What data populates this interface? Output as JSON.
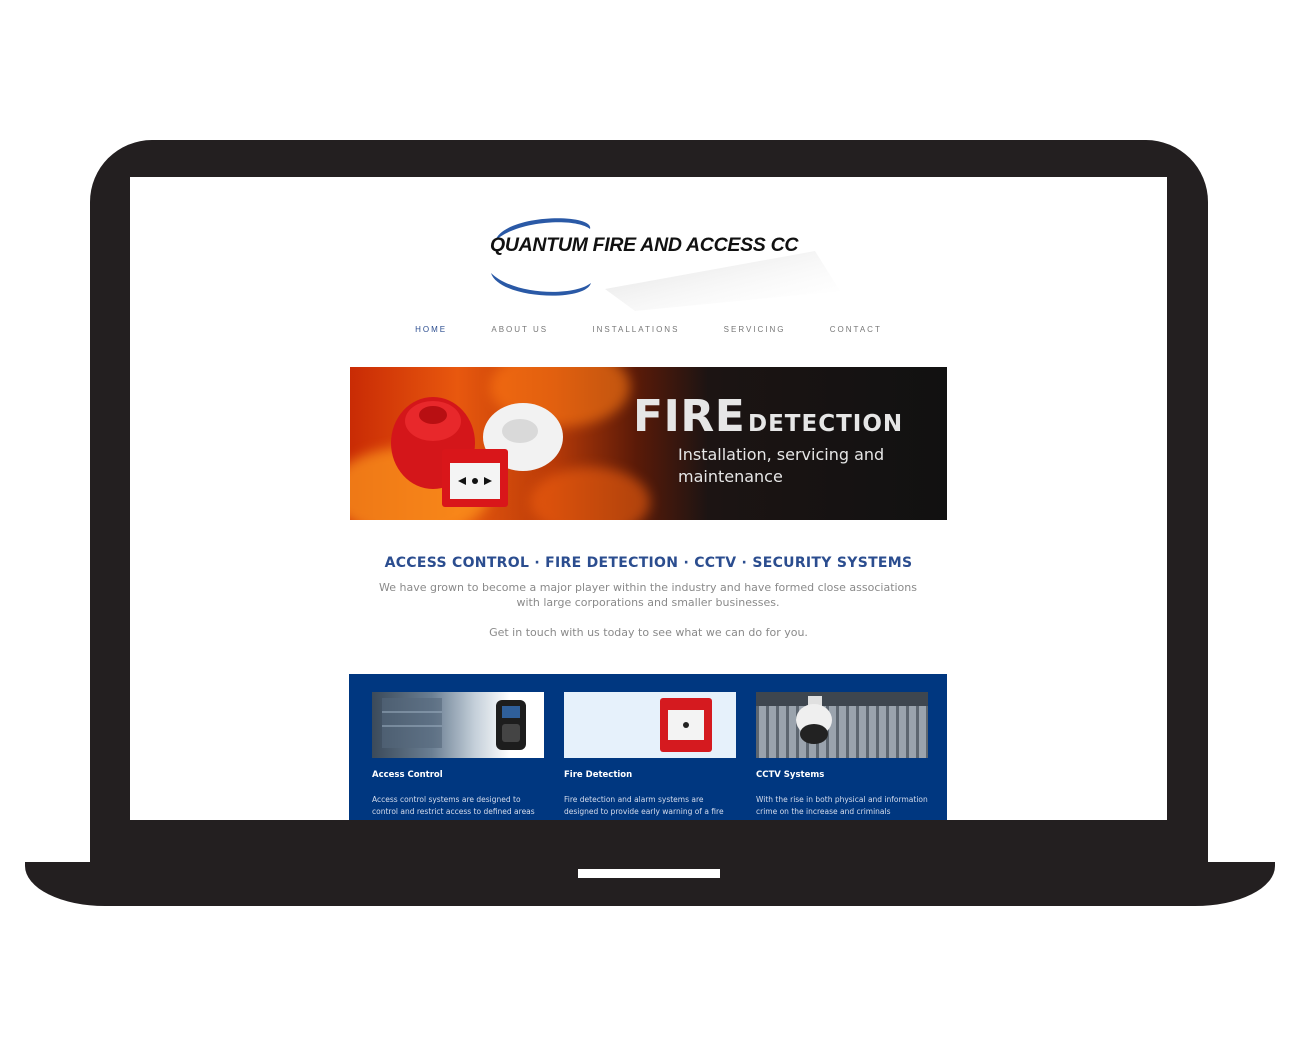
{
  "site": {
    "logo_text": "QUANTUM FIRE AND ACCESS CC"
  },
  "nav": {
    "items": [
      "HOME",
      "ABOUT US",
      "INSTALLATIONS",
      "SERVICING",
      "CONTACT"
    ],
    "active": "HOME"
  },
  "banner": {
    "title_big": "FIRE",
    "title_small": "DETECTION",
    "subtitle": "Installation, servicing and maintenance"
  },
  "intro": {
    "tagline": "ACCESS CONTROL · FIRE DETECTION · CCTV · SECURITY SYSTEMS",
    "description": "We have grown to become a major player within the industry and have formed close associations with large corporations and smaller businesses.",
    "cta": "Get in touch with us today to see what we can do for you."
  },
  "services": [
    {
      "title": "Access Control",
      "text": "Access control systems are designed to control and restrict access to defined areas within a"
    },
    {
      "title": "Fire Detection",
      "text": "Fire detection and alarm systems are designed to provide early warning of a fire condition to"
    },
    {
      "title": "CCTV Systems",
      "text": "With the rise in both physical and information crime on the increase and criminals becoming"
    }
  ],
  "colors": {
    "brand_blue": "#2b4d8f",
    "panel_blue": "#003780",
    "laptop_frame": "#231f20"
  }
}
